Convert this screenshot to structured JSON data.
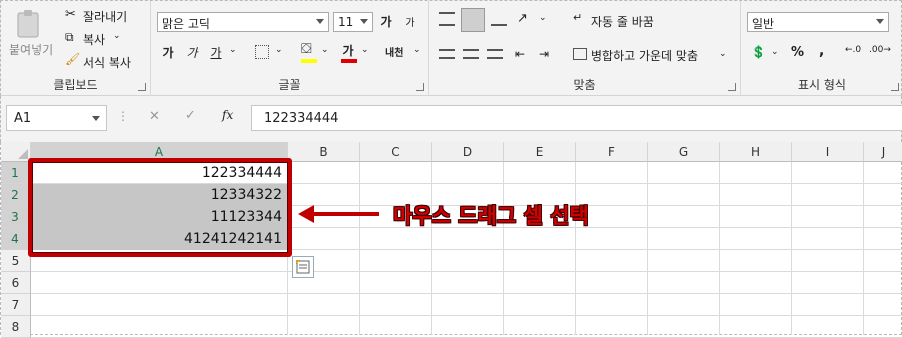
{
  "ribbon": {
    "clipboard": {
      "paste_label": "붙여넣기",
      "cut_label": "잘라내기",
      "copy_label": "복사",
      "format_painter_label": "서식 복사",
      "group_label": "클립보드"
    },
    "font": {
      "font_name": "맑은 고딕",
      "font_size": "11",
      "grow_label": "가",
      "shrink_label": "가",
      "bold_label": "가",
      "italic_label": "가",
      "underline_label": "가",
      "font_color_label": "가",
      "phonetic_label": "내천",
      "group_label": "글꼴"
    },
    "alignment": {
      "wrap_text_label": "자동 줄 바꿈",
      "merge_center_label": "병합하고 가운데 맞춤",
      "group_label": "맞춤"
    },
    "number": {
      "format_value": "일반",
      "percent_label": "%",
      "comma_label": ",",
      "group_label": "표시 형식"
    }
  },
  "formula_bar": {
    "name_box": "A1",
    "fx_label": "fx",
    "formula": "122334444"
  },
  "sheet": {
    "columns": [
      "A",
      "B",
      "C",
      "D",
      "E",
      "F",
      "G",
      "H",
      "I",
      "J"
    ],
    "rows": [
      "1",
      "2",
      "3",
      "4",
      "5",
      "6",
      "7",
      "8"
    ],
    "cells": [
      "122334444",
      "12334322",
      "11123344",
      "41241242141"
    ]
  },
  "annotation": {
    "callout_text": "마우스 드래그 셀 선택",
    "color": "#c00000"
  }
}
